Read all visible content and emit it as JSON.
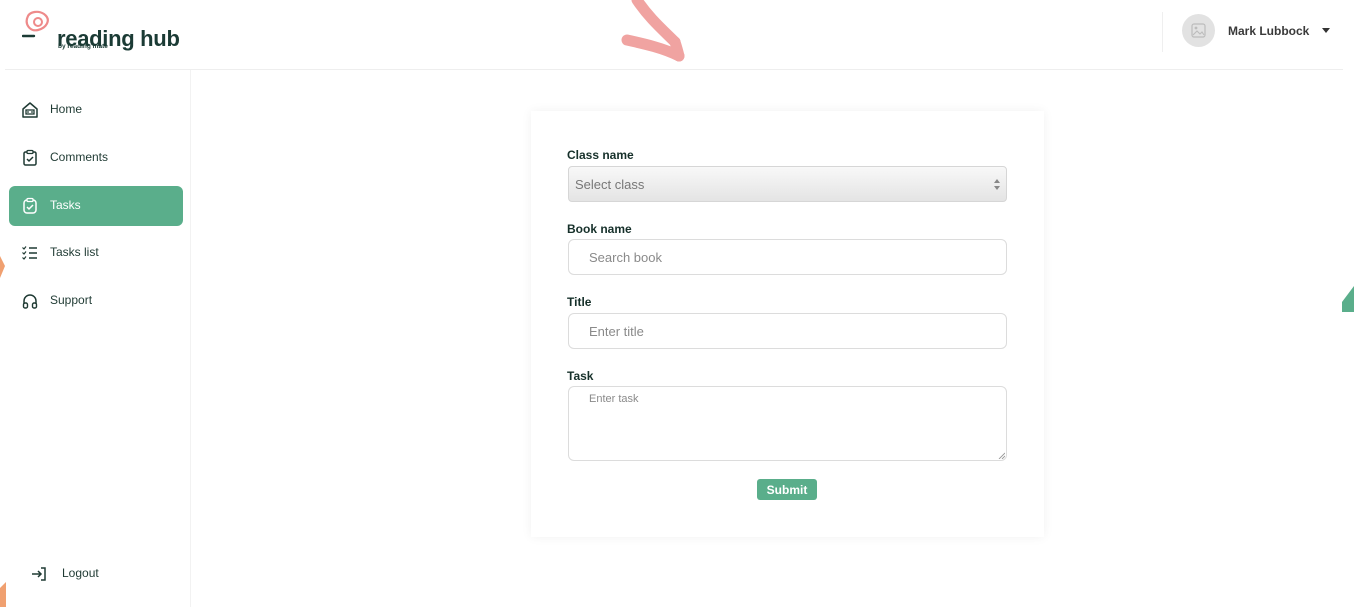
{
  "brand": {
    "name": "reading hub",
    "tagline": "by reading mate",
    "accent": "#5aae8b",
    "logo_color": "#ee8a8a",
    "text_color": "#1b3b35"
  },
  "user": {
    "name": "Mark Lubbock",
    "avatar_icon": "image-icon",
    "menu_icon": "caret-down-icon"
  },
  "sidebar": {
    "items": [
      {
        "label": "Home",
        "icon": "home-icon",
        "active": false
      },
      {
        "label": "Comments",
        "icon": "clipboard-check-icon",
        "active": false
      },
      {
        "label": "Tasks",
        "icon": "clipboard-check-icon",
        "active": true
      },
      {
        "label": "Tasks list",
        "icon": "checklist-icon",
        "active": false
      },
      {
        "label": "Support",
        "icon": "headset-icon",
        "active": false
      }
    ],
    "logout": {
      "label": "Logout",
      "icon": "logout-icon"
    }
  },
  "form": {
    "class_label": "Class name",
    "class_select": {
      "selected": "Select class"
    },
    "book_label": "Book name",
    "book_placeholder": "Search book",
    "title_label": "Title",
    "title_placeholder": "Enter title",
    "task_label": "Task",
    "task_placeholder": "Enter task",
    "submit_label": "Submit"
  },
  "decor": {
    "arrow_color": "#f0a3a1",
    "left_shape_color": "#f0a070",
    "right_shape_color": "#5aae8b"
  }
}
